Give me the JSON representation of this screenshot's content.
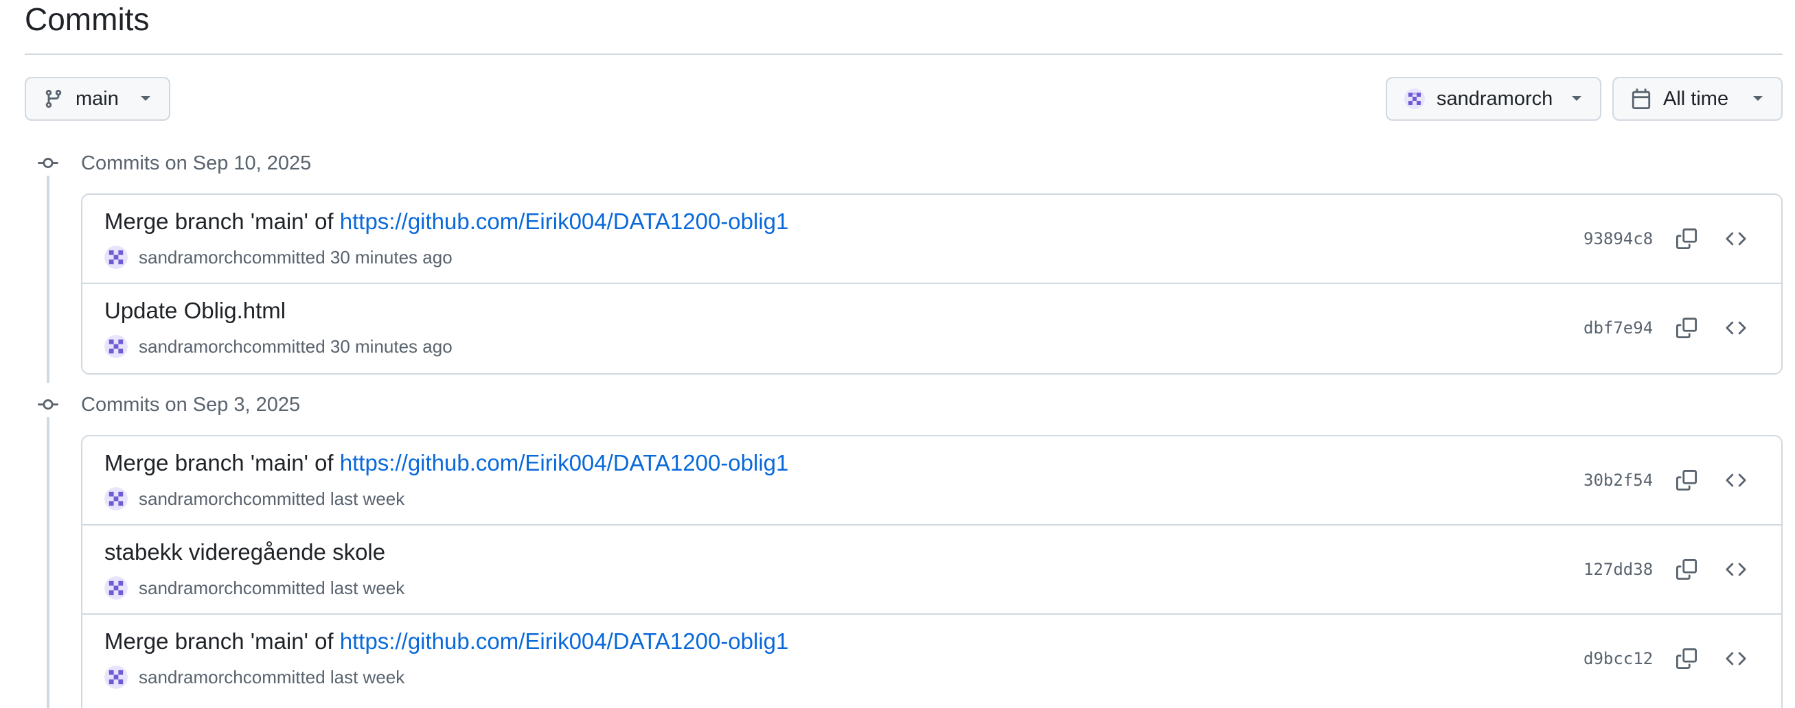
{
  "page": {
    "title": "Commits"
  },
  "filters": {
    "branch": {
      "label": "main",
      "icon": "git-branch-icon"
    },
    "author": {
      "label": "sandramorch",
      "icon": "avatar"
    },
    "time": {
      "label": "All time",
      "icon": "calendar-icon"
    }
  },
  "groups": [
    {
      "label": "Commits on Sep 10, 2025",
      "commits": [
        {
          "message_prefix": "Merge branch 'main' of ",
          "message_link": "https://github.com/Eirik004/DATA1200-oblig1",
          "author": "sandramorch",
          "meta_rest": " committed 30 minutes ago",
          "sha": "93894c8"
        },
        {
          "message_prefix": "Update Oblig.html",
          "message_link": "",
          "author": "sandramorch",
          "meta_rest": " committed 30 minutes ago",
          "sha": "dbf7e94"
        }
      ]
    },
    {
      "label": "Commits on Sep 3, 2025",
      "commits": [
        {
          "message_prefix": "Merge branch 'main' of ",
          "message_link": "https://github.com/Eirik004/DATA1200-oblig1",
          "author": "sandramorch",
          "meta_rest": " committed last week",
          "sha": "30b2f54"
        },
        {
          "message_prefix": "stabekk videregående skole",
          "message_link": "",
          "author": "sandramorch",
          "meta_rest": " committed last week",
          "sha": "127dd38"
        },
        {
          "message_prefix": "Merge branch 'main' of ",
          "message_link": "https://github.com/Eirik004/DATA1200-oblig1",
          "author": "sandramorch",
          "meta_rest": " committed last week",
          "sha": "d9bcc12"
        }
      ]
    }
  ],
  "colors": {
    "link": "#0969da",
    "muted": "#59636e",
    "border": "#d1d9e0",
    "avatar": "#6e5bd6"
  }
}
